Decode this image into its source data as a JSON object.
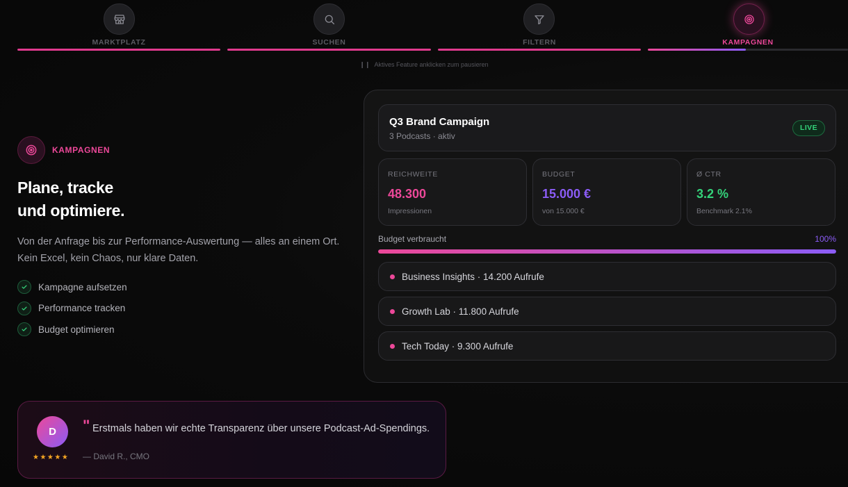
{
  "steps": [
    {
      "label": "MARKTPLATZ",
      "icon": "store-icon",
      "progress": 1.0
    },
    {
      "label": "SUCHEN",
      "icon": "search-icon",
      "progress": 1.0
    },
    {
      "label": "FILTERN",
      "icon": "filter-icon",
      "progress": 1.0
    },
    {
      "label": "KAMPAGNEN",
      "icon": "target-icon",
      "progress": 0.49,
      "active": true
    }
  ],
  "hint": "Aktives Feature anklicken zum pausieren",
  "feature": {
    "name": "KAMPAGNEN",
    "headline_line1": "Plane, tracke",
    "headline_line2": "und optimiere.",
    "lead": "Von der Anfrage bis zur Performance-Auswertung — alles an einem Ort. Kein Excel, kein Chaos, nur klare Daten.",
    "checks": [
      "Kampagne aufsetzen",
      "Performance tracken",
      "Budget optimieren"
    ]
  },
  "campaign": {
    "title": "Q3 Brand Campaign",
    "subtitle": "3 Podcasts · aktiv",
    "status": "LIVE",
    "metrics": [
      {
        "key": "REICHWEITE",
        "value": "48.300",
        "sub": "Impressionen",
        "color": "#ec4899"
      },
      {
        "key": "BUDGET",
        "value": "15.000 €",
        "sub": "von 15.000 €",
        "color": "#8b5cf6"
      },
      {
        "key": "Ø CTR",
        "value": "3.2 %",
        "sub": "Benchmark 2.1%",
        "color": "#34d27a"
      }
    ],
    "budget_label": "Budget verbraucht",
    "budget_pct_text": "100%",
    "budget_fraction": 1.0,
    "podcasts": [
      "Business Insights · 14.200 Aufrufe",
      "Growth Lab · 11.800 Aufrufe",
      "Tech Today · 9.300 Aufrufe"
    ]
  },
  "testimonial": {
    "avatar_letter": "D",
    "stars": "★★★★★",
    "quote_mark": "\"",
    "text": "Erstmals haben wir echte Transparenz über unsere Podcast-Ad-Spendings.",
    "author": "— David R., CMO"
  },
  "colors": {
    "accent": "#ec4899",
    "accent2": "#8b5cf6",
    "success": "#34d27a"
  }
}
